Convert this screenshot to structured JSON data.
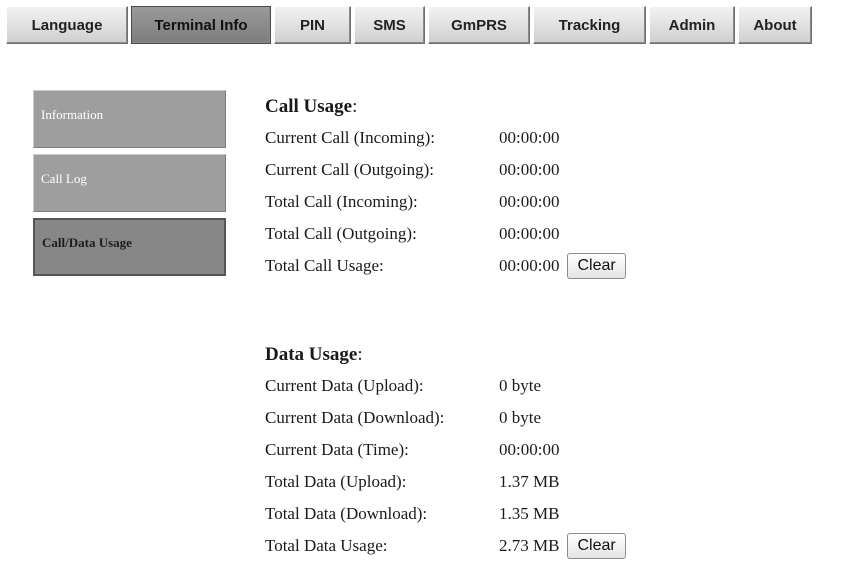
{
  "tabs": [
    "Language",
    "Terminal Info",
    "PIN",
    "SMS",
    "GmPRS",
    "Tracking",
    "Admin",
    "About"
  ],
  "active_tab": "Terminal Info",
  "sidenav": {
    "items": [
      "Information",
      "Call Log",
      "Call/Data Usage"
    ],
    "active": "Call/Data Usage"
  },
  "call_usage": {
    "title": "Call Usage",
    "rows": [
      {
        "label": "Current Call (Incoming):",
        "value": "00:00:00"
      },
      {
        "label": "Current Call (Outgoing):",
        "value": "00:00:00"
      },
      {
        "label": "Total Call (Incoming):",
        "value": "00:00:00"
      },
      {
        "label": "Total Call (Outgoing):",
        "value": "00:00:00"
      },
      {
        "label": "Total Call Usage:",
        "value": "00:00:00"
      }
    ],
    "clear_label": "Clear"
  },
  "data_usage": {
    "title": "Data Usage",
    "rows": [
      {
        "label": "Current Data (Upload):",
        "value": "0 byte"
      },
      {
        "label": "Current Data (Download):",
        "value": "0 byte"
      },
      {
        "label": "Current Data (Time):",
        "value": "00:00:00"
      },
      {
        "label": "Total Data (Upload):",
        "value": "1.37 MB"
      },
      {
        "label": "Total Data (Download):",
        "value": "1.35 MB"
      },
      {
        "label": "Total Data Usage:",
        "value": "2.73 MB"
      }
    ],
    "clear_label": "Clear"
  }
}
